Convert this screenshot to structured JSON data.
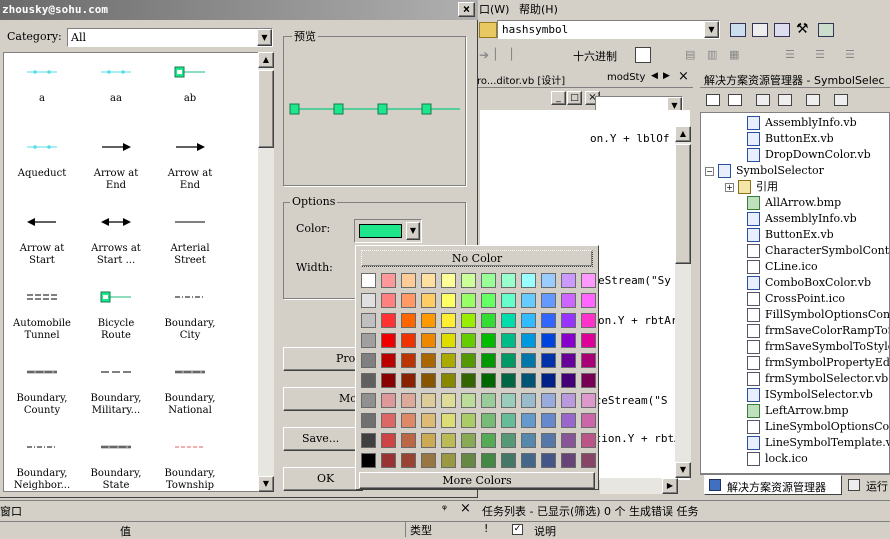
{
  "dialog": {
    "title": "zhousky@sohu.com",
    "category_label": "Category:",
    "category_value": "All",
    "preview_label": "预览",
    "options_label": "Options",
    "color_label": "Color:",
    "width_label": "Width:",
    "properties_btn": "Pro",
    "more_btn": "Mor",
    "save_btn": "Save...",
    "ok_btn": "OK",
    "color_value": "#1ee68a"
  },
  "symbols": [
    {
      "name": "a",
      "label": "a",
      "kind": "cyan-dots"
    },
    {
      "name": "aa",
      "label": "aa",
      "kind": "cyan-dots"
    },
    {
      "name": "ab",
      "label": "ab",
      "kind": "green-box"
    },
    {
      "name": "aqueduct",
      "label": "Aqueduct",
      "kind": "cyan-dots"
    },
    {
      "name": "arrow-at-end-1",
      "label": "Arrow at\nEnd",
      "kind": "arrow-right"
    },
    {
      "name": "arrow-at-end-2",
      "label": "Arrow at\nEnd",
      "kind": "arrow-right"
    },
    {
      "name": "arrow-at-start",
      "label": "Arrow at\nStart",
      "kind": "arrow-left"
    },
    {
      "name": "arrows-at-start",
      "label": "Arrows at\nStart ...",
      "kind": "arrow-both"
    },
    {
      "name": "arterial-street",
      "label": "Arterial\nStreet",
      "kind": "line"
    },
    {
      "name": "automobile-tunnel",
      "label": "Automobile\nTunnel",
      "kind": "double"
    },
    {
      "name": "bicycle-route",
      "label": "Bicycle\nRoute",
      "kind": "green-box"
    },
    {
      "name": "boundary-city",
      "label": "Boundary,\nCity",
      "kind": "dash-dot"
    },
    {
      "name": "boundary-county",
      "label": "Boundary,\nCounty",
      "kind": "gray-band"
    },
    {
      "name": "boundary-military",
      "label": "Boundary,\nMilitary...",
      "kind": "dash"
    },
    {
      "name": "boundary-national",
      "label": "Boundary,\nNational",
      "kind": "gray-band"
    },
    {
      "name": "boundary-neighbor",
      "label": "Boundary,\nNeighbor...",
      "kind": "dash-dot"
    },
    {
      "name": "boundary-state",
      "label": "Boundary,\nState",
      "kind": "gray-band"
    },
    {
      "name": "boundary-township",
      "label": "Boundary,\nTownship",
      "kind": "red-dash"
    }
  ],
  "palette": {
    "no_color": "No Color",
    "more_colors": "More Colors",
    "rows": [
      [
        "#ffffff",
        "#ff9999",
        "#ffcc99",
        "#ffe0a0",
        "#ffff99",
        "#ccff99",
        "#99ff99",
        "#99ffcc",
        "#99ffff",
        "#99ccff",
        "#cc99ff",
        "#ff99ff"
      ],
      [
        "#e0e0e0",
        "#ff8080",
        "#ff9966",
        "#ffcc66",
        "#ffff66",
        "#99ff66",
        "#66ff66",
        "#66ffcc",
        "#66ccff",
        "#6699ff",
        "#cc66ff",
        "#ff66ff"
      ],
      [
        "#c0c0c0",
        "#ff3333",
        "#ff6600",
        "#ff9900",
        "#ffee33",
        "#99ee00",
        "#33dd33",
        "#00ddaa",
        "#33bbff",
        "#3366ff",
        "#9933ff",
        "#ff33cc"
      ],
      [
        "#a0a0a0",
        "#ee0000",
        "#ee3300",
        "#ee8800",
        "#dddd00",
        "#66cc00",
        "#00bb00",
        "#00bb88",
        "#0099dd",
        "#0044dd",
        "#8800cc",
        "#dd0099"
      ],
      [
        "#808080",
        "#bb0000",
        "#bb3300",
        "#aa6600",
        "#aaaa00",
        "#559900",
        "#009900",
        "#009966",
        "#0077aa",
        "#0033aa",
        "#660099",
        "#aa0077"
      ],
      [
        "#606060",
        "#880000",
        "#882200",
        "#885500",
        "#888800",
        "#336600",
        "#006600",
        "#006644",
        "#005577",
        "#002288",
        "#440077",
        "#770055"
      ],
      [
        "#909090",
        "#dd9999",
        "#ddaa99",
        "#ddcc99",
        "#dddd99",
        "#bbdd99",
        "#99cc99",
        "#99ccbb",
        "#99bbcc",
        "#99aadd",
        "#bb99dd",
        "#dd99cc"
      ],
      [
        "#707070",
        "#dd6666",
        "#dd8866",
        "#ddbb77",
        "#dddd77",
        "#aacc66",
        "#77bb77",
        "#66bb99",
        "#6699cc",
        "#6688cc",
        "#9966cc",
        "#cc66aa"
      ],
      [
        "#404040",
        "#cc4444",
        "#bb6644",
        "#ccaa55",
        "#bbbb55",
        "#88aa55",
        "#55aa55",
        "#559977",
        "#5588aa",
        "#5577aa",
        "#885599",
        "#bb5588"
      ],
      [
        "#000000",
        "#993333",
        "#994433",
        "#997744",
        "#999944",
        "#668844",
        "#448844",
        "#447766",
        "#446688",
        "#445588",
        "#664477",
        "#884466"
      ]
    ]
  },
  "ide": {
    "menu_help": "帮助(H)",
    "menu_left": "口(W)",
    "combo_value": "hashsymbol",
    "hex_label": "十六进制",
    "doc_tab_1": "ro...ditor.vb [设计]",
    "doc_tab_2": "modSty",
    "code_lines": [
      "on.Y + lblOf",
      "eStream(\"Sy",
      "on.Y + rbtAr",
      "rceStream(\"S",
      "ition.Y + rbtA"
    ],
    "solution_title": "解决方案资源管理器 - SymbolSelec",
    "tree": [
      {
        "label": "AssemblyInfo.vb",
        "icon": "vb",
        "indent": 3
      },
      {
        "label": "ButtonEx.vb",
        "icon": "vb",
        "indent": 3
      },
      {
        "label": "DropDownColor.vb",
        "icon": "vb",
        "indent": 3
      },
      {
        "label": "SymbolSelector",
        "icon": "vb",
        "indent": 1
      },
      {
        "label": "引用",
        "icon": "ref",
        "indent": 2
      },
      {
        "label": "AllArrow.bmp",
        "icon": "img",
        "indent": 3
      },
      {
        "label": "AssemblyInfo.vb",
        "icon": "vb",
        "indent": 3
      },
      {
        "label": "ButtonEx.vb",
        "icon": "vb",
        "indent": 3
      },
      {
        "label": "CharacterSymbolContro",
        "icon": "file",
        "indent": 3
      },
      {
        "label": "CLine.ico",
        "icon": "file",
        "indent": 3
      },
      {
        "label": "ComboBoxColor.vb",
        "icon": "vb",
        "indent": 3
      },
      {
        "label": "CrossPoint.ico",
        "icon": "file",
        "indent": 3
      },
      {
        "label": "FillSymbolOptionsCont",
        "icon": "file",
        "indent": 3
      },
      {
        "label": "frmSaveColorRampToSty",
        "icon": "file",
        "indent": 3
      },
      {
        "label": "frmSaveSymbolToStyle.",
        "icon": "file",
        "indent": 3
      },
      {
        "label": "frmSymbolPropertyEdit",
        "icon": "file",
        "indent": 3
      },
      {
        "label": "frmSymbolSelector.vb",
        "icon": "file",
        "indent": 3
      },
      {
        "label": "ISymbolSelector.vb",
        "icon": "vb",
        "indent": 3
      },
      {
        "label": "LeftArrow.bmp",
        "icon": "img",
        "indent": 3
      },
      {
        "label": "LineSymbolOptionsCont",
        "icon": "file",
        "indent": 3
      },
      {
        "label": "LineSymbolTemplate.vb",
        "icon": "vb",
        "indent": 3
      },
      {
        "label": "lock.ico",
        "icon": "file",
        "indent": 3
      }
    ],
    "bottom_tab_solution": "解决方案资源管理器",
    "bottom_tab_run": "运行",
    "window_label": "窗口",
    "value_header": "值",
    "type_header": "类型",
    "tasklist_title": "任务列表 - 已显示(筛选) 0 个 生成错误 任务",
    "desc_header": "说明",
    "pin_glyph": "ᵠ",
    "close_glyph": "×"
  }
}
